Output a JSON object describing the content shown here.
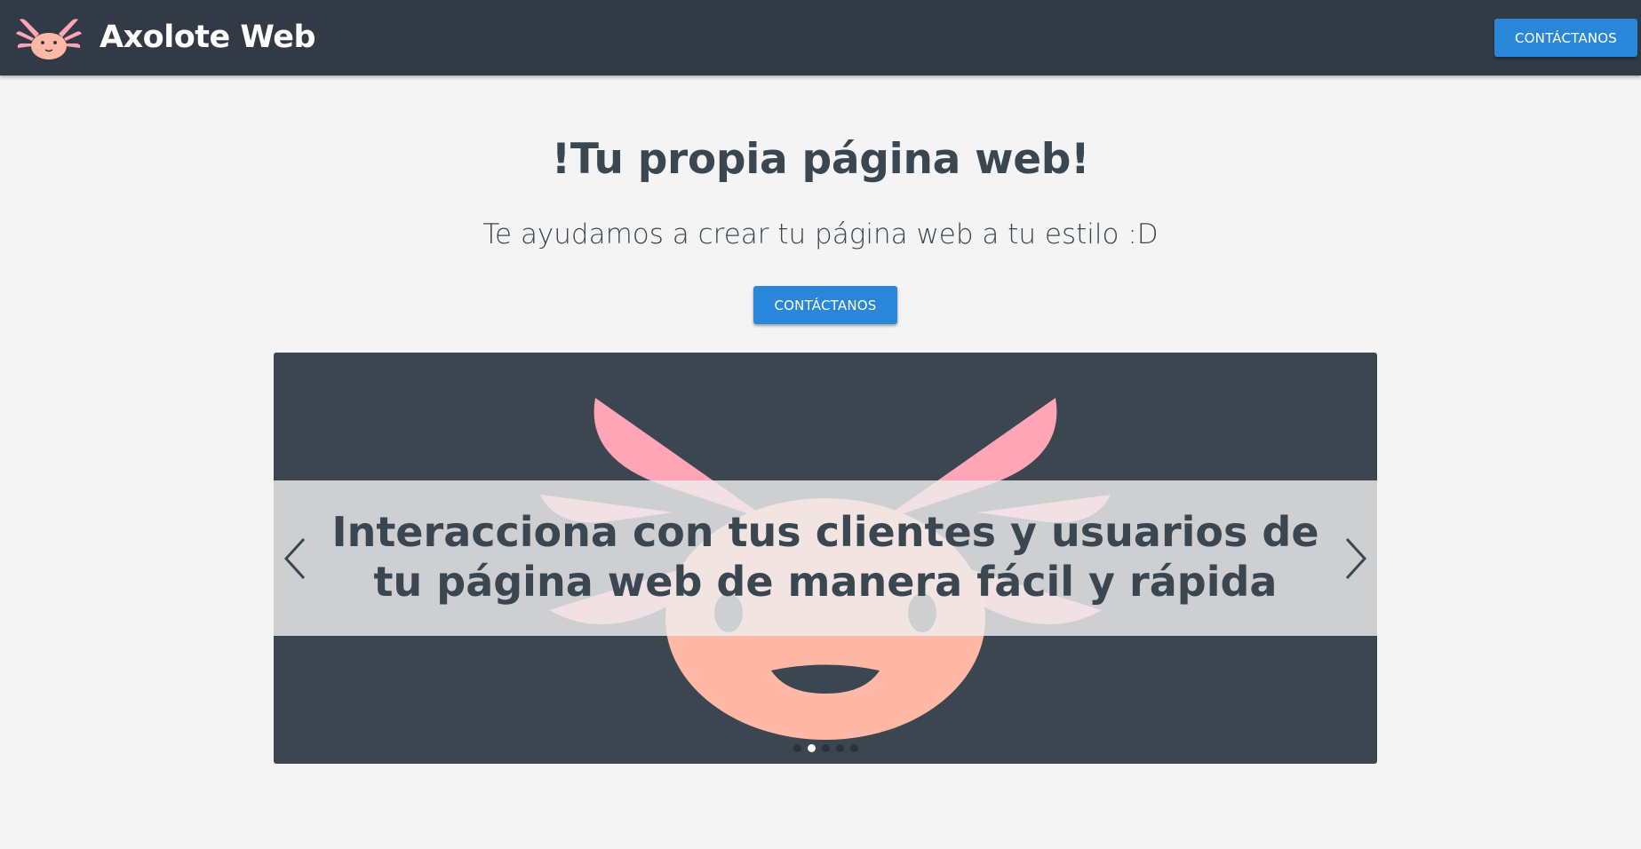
{
  "navbar": {
    "brand_text": "Axolote Web",
    "brand_logo_icon": "axolotl-logo-icon",
    "contact_label": "CONTÁCTANOS",
    "background_color": "#323a45",
    "accent_color": "#2a86d8"
  },
  "hero": {
    "title": "!Tu propia página web!",
    "subtitle": "Te ayudamos a crear tu página web a tu estilo :D",
    "contact_label": "CONTÁCTANOS"
  },
  "carousel": {
    "caption": "Interacciona con tus clientes y usuarios de tu página web de manera fácil y rápida",
    "prev_icon": "chevron-left-icon",
    "next_icon": "chevron-right-icon",
    "slide_count": 5,
    "active_slide": 2,
    "background_color": "#3c4650",
    "axolotl_pink": "#ffa5b6",
    "axolotl_face": "#ffb7a6"
  }
}
